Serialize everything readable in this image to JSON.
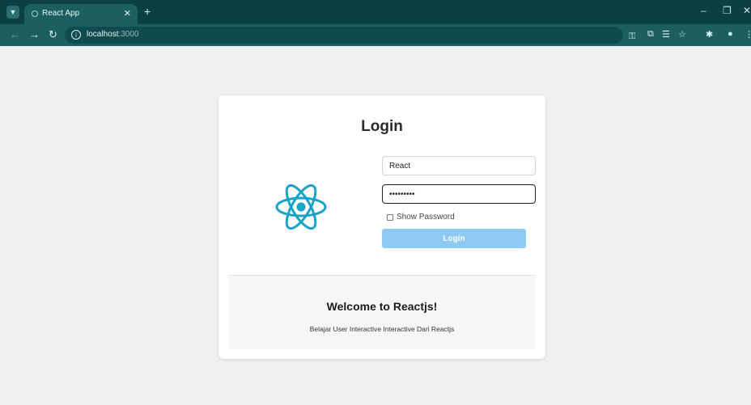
{
  "browser": {
    "tab_title": "React App",
    "url_host": "localhost",
    "url_port": ":3000"
  },
  "login": {
    "heading": "Login",
    "username_value": "React",
    "password_value": "secret123",
    "show_password_label": "Show Password",
    "submit_label": "Login",
    "logo_color": "#1aa3c6",
    "button_color": "#8ec9f3"
  },
  "welcome": {
    "title": "Welcome to Reactjs!",
    "text": "Belajar User Interactive Interactive Dari Reactjs"
  },
  "icons": [
    "tab-list-icon",
    "tab-favicon-icon",
    "tab-close-icon",
    "new-tab-icon",
    "minimize-icon",
    "restore-icon",
    "close-window-icon",
    "back-icon",
    "forward-icon",
    "reload-icon",
    "site-info-icon",
    "password-key-icon",
    "install-app-icon",
    "translate-icon",
    "bookmark-star-icon",
    "extensions-icon",
    "profile-icon",
    "menu-icon",
    "react-logo-icon"
  ]
}
